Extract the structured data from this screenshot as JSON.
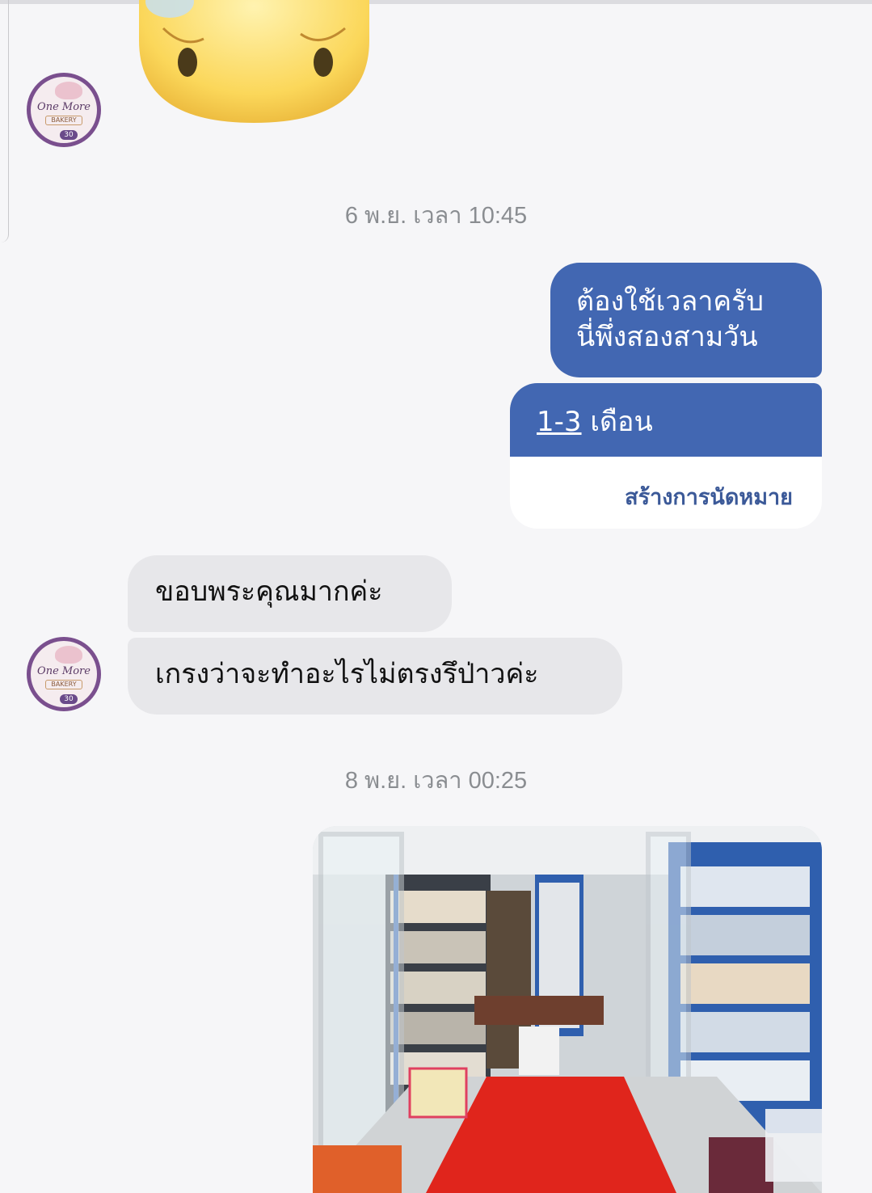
{
  "conversation": {
    "timestamp_1": "6 พ.ย. เวลา 10:45",
    "timestamp_2": "8 พ.ย. เวลา 00:25",
    "avatar_text": {
      "brand_line1": "One More",
      "brand_line2": "BAKERY",
      "badge": "30"
    },
    "outgoing_1": {
      "line1": "ต้องใช้เวลาครับ",
      "line2": "นี่พึ่งสองสามวัน"
    },
    "outgoing_card": {
      "link_text": "1-3",
      "text_rest": " เดือน",
      "action_label": "สร้างการนัดหมาย"
    },
    "incoming_1": "ขอบพระคุณมากค่ะ",
    "incoming_2": "เกรงว่าจะทำอะไรไม่ตรงรึป่าวค่ะ"
  },
  "colors": {
    "outgoing_bubble": "#4267b2",
    "incoming_bubble": "#e7e7ea",
    "action_text": "#3b5998",
    "timestamp": "#8a8d91",
    "background": "#f6f6f8"
  },
  "icons": [
    "sad-face-emoji-sticker",
    "bakery-avatar-icon",
    "store-photo"
  ]
}
